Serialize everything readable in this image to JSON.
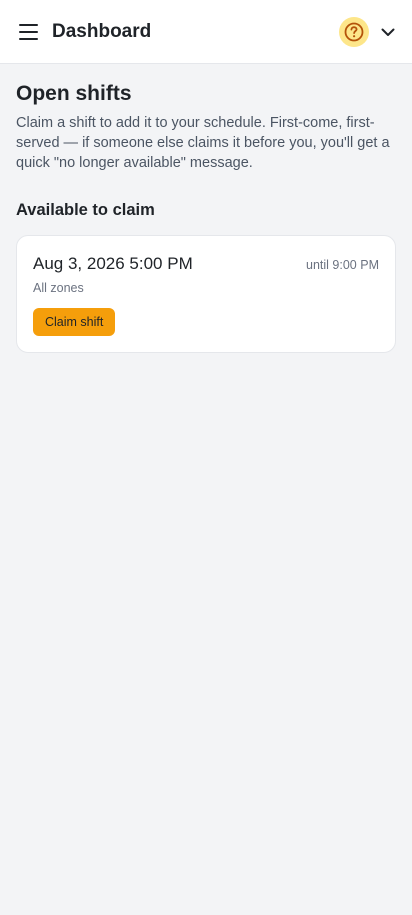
{
  "header": {
    "title": "Dashboard",
    "menu_icon": "hamburger-menu-icon",
    "help_icon": "question-circle-icon",
    "dropdown_icon": "chevron-down-icon"
  },
  "main": {
    "title": "Open shifts",
    "description": "Claim a shift to add it to your schedule. First-come, first-served — if someone else claims it before you, you'll get a quick \"no longer available\" message.",
    "section_title": "Available to claim",
    "shifts": [
      {
        "start": "Aug 3, 2026 5:00 PM",
        "until": "until 9:00 PM",
        "zone": "All zones",
        "action_label": "Claim shift"
      }
    ]
  },
  "colors": {
    "accent": "#f59e0b",
    "help_badge_bg": "#fde68a",
    "background": "#f3f4f6",
    "card_bg": "#ffffff"
  }
}
